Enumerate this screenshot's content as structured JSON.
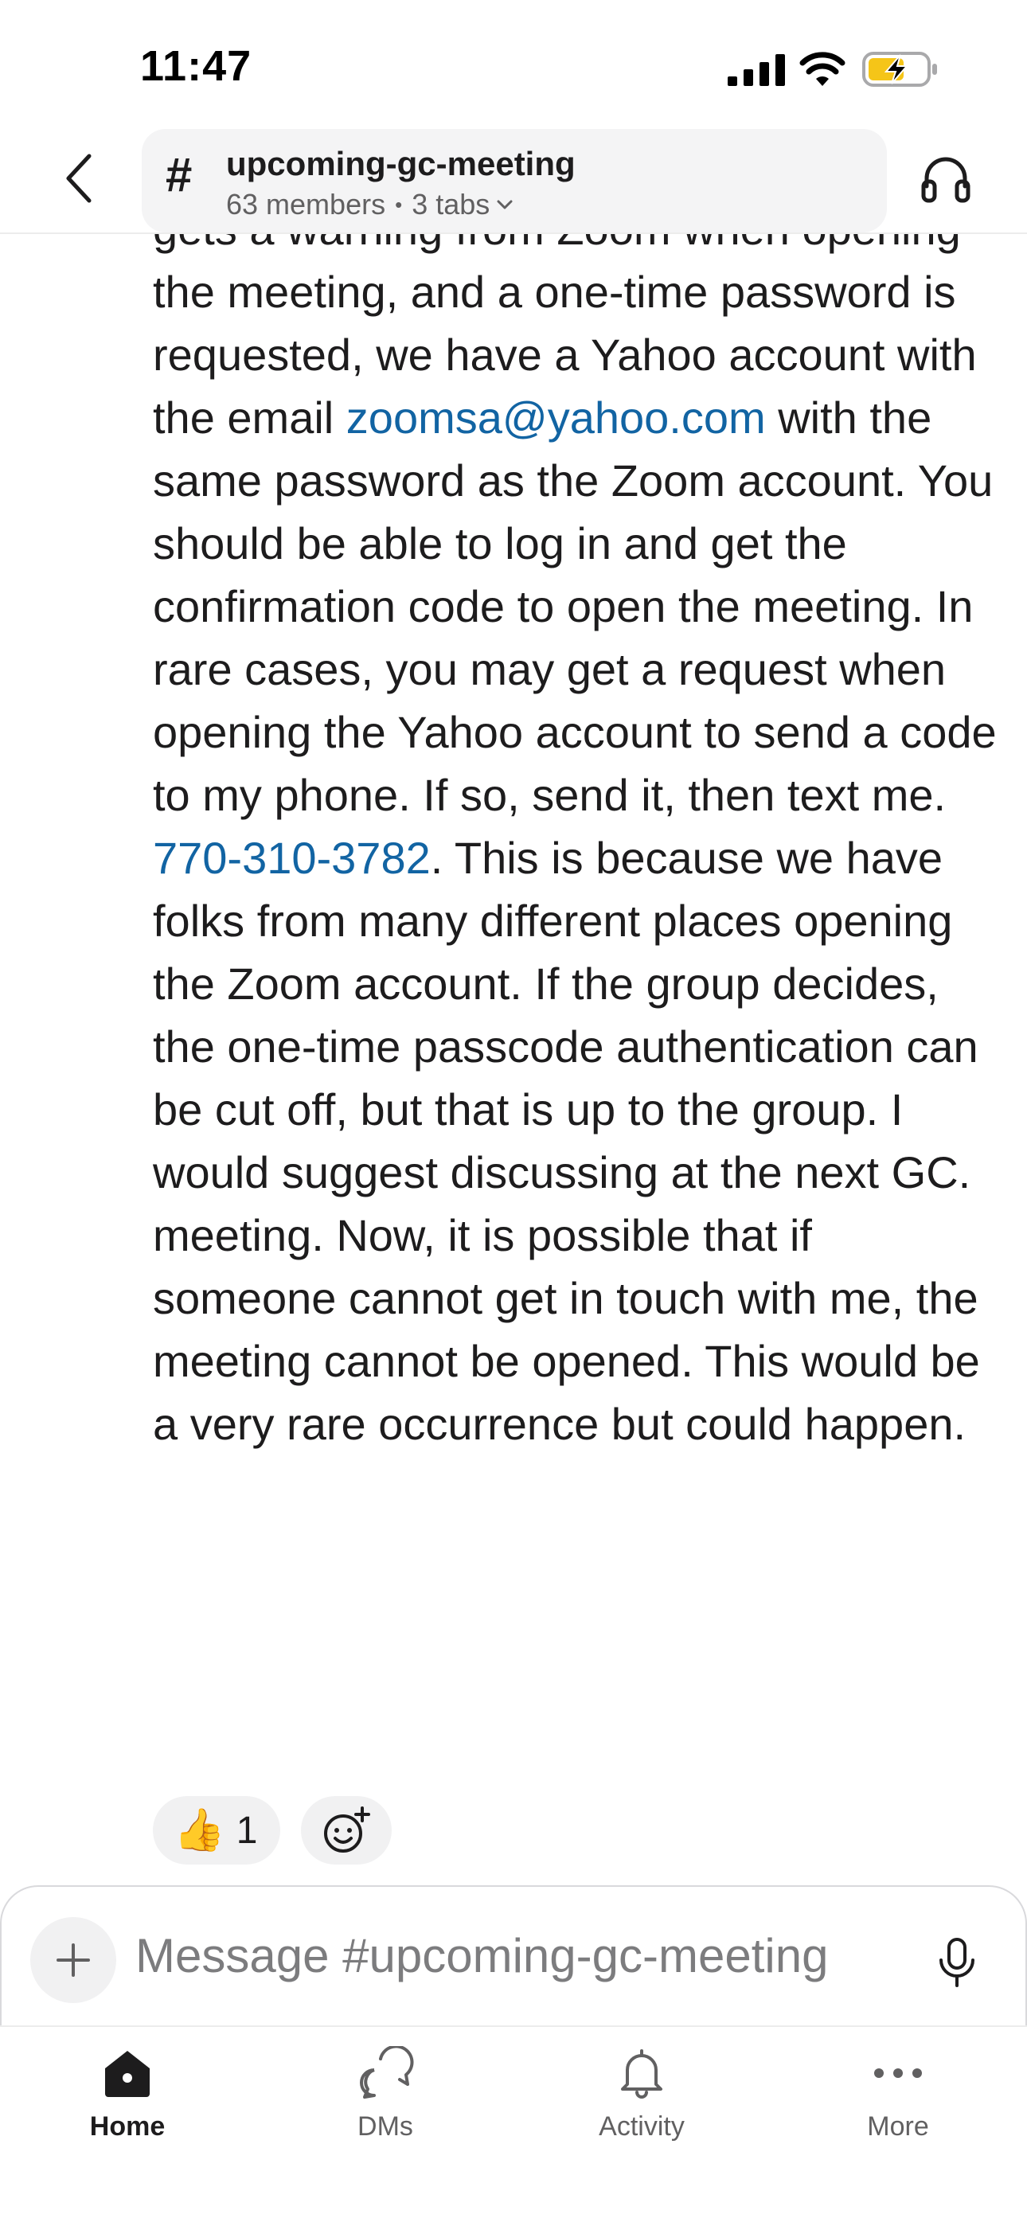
{
  "status_bar": {
    "time": "11:47",
    "icons": [
      "cellular-signal-icon",
      "wifi-icon",
      "battery-charging-icon"
    ]
  },
  "header": {
    "back_icon": "chevron-left-icon",
    "channel_icon": "#",
    "channel_name": "upcoming-gc-meeting",
    "members": "63 members",
    "separator": "•",
    "tabs": "3 tabs",
    "huddle_icon": "headphones-icon"
  },
  "message": {
    "text_before_email": "gets a warning from Zoom when opening the meeting, and a one-time password is requested, we have a Yahoo account with the email ",
    "email": "zoomsa@yahoo.com",
    "text_after_email": " with the same password as the Zoom account. You should be able to log in and get the confirmation code to open the meeting. In rare cases, you may get a request when opening the Yahoo account to send a code to my phone. If so, send it, then text me. ",
    "phone": "770-310-3782",
    "text_after_phone": ". This is because we have folks from many different places opening the Zoom account. If the group decides, the one-time passcode authentication can be cut off, but that is up to the group. I would suggest discussing at the next GC. meeting. Now, it is possible that if someone cannot get in touch with me, the meeting cannot be opened. This would be a very rare occurrence but could happen."
  },
  "reactions": [
    {
      "emoji": "👍",
      "count": "1"
    }
  ],
  "add_reaction_icon": "add-reaction-icon",
  "composer": {
    "placeholder": "Message #upcoming-gc-meeting",
    "plus_icon": "plus-icon",
    "mic_icon": "microphone-icon"
  },
  "tab_bar": {
    "tabs": [
      {
        "label": "Home",
        "icon": "home-icon",
        "active": true
      },
      {
        "label": "DMs",
        "icon": "dms-icon",
        "active": false
      },
      {
        "label": "Activity",
        "icon": "bell-icon",
        "active": false
      },
      {
        "label": "More",
        "icon": "more-icon",
        "active": false
      }
    ]
  },
  "colors": {
    "link": "#1264a3",
    "text": "#1d1c1d",
    "muted": "#616061",
    "battery_fill": "#f5c518"
  }
}
